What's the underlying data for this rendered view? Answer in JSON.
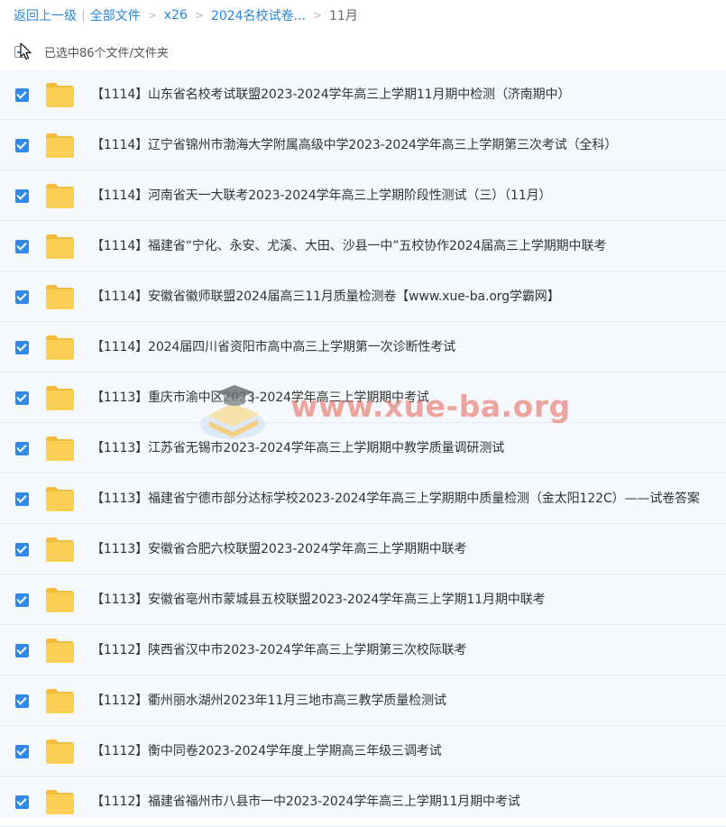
{
  "breadcrumb": {
    "back": "返回上一级",
    "all_files": "全部文件",
    "level1": "x26",
    "level2": "2024名校试卷...",
    "current": "11月",
    "pipe": "|",
    "sep": ">"
  },
  "selection": {
    "text": "已选中86个文件/文件夹"
  },
  "files": [
    {
      "name": "【1114】山东省名校考试联盟2023-2024学年高三上学期11月期中检测（济南期中）"
    },
    {
      "name": "【1114】辽宁省锦州市渤海大学附属高级中学2023-2024学年高三上学期第三次考试（全科）"
    },
    {
      "name": "【1114】河南省天一大联考2023-2024学年高三上学期阶段性测试（三）（11月）"
    },
    {
      "name": "【1114】福建省“宁化、永安、尤溪、大田、沙县一中”五校协作2024届高三上学期期中联考"
    },
    {
      "name": "【1114】安徽省徽师联盟2024届高三11月质量检测卷【www.xue-ba.org学霸网】"
    },
    {
      "name": "【1114】2024届四川省资阳市高中高三上学期第一次诊断性考试"
    },
    {
      "name": "【1113】重庆市渝中区2023-2024学年高三上学期期中考试"
    },
    {
      "name": "【1113】江苏省无锡市2023-2024学年高三上学期期中教学质量调研测试"
    },
    {
      "name": "【1113】福建省宁德市部分达标学校2023-2024学年高三上学期期中质量检测（金太阳122C）——试卷答案"
    },
    {
      "name": "【1113】安徽省合肥六校联盟2023-2024学年高三上学期期中联考"
    },
    {
      "name": "【1113】安徽省亳州市蒙城县五校联盟2023-2024学年高三上学期11月期中联考"
    },
    {
      "name": "【1112】陕西省汉中市2023-2024学年高三上学期第三次校际联考"
    },
    {
      "name": "【1112】衢州丽水湖州2023年11月三地市高三教学质量检测试"
    },
    {
      "name": "【1112】衡中同卷2023-2024学年度上学期高三年级三调考试"
    },
    {
      "name": "【1112】福建省福州市八县市一中2023-2024学年高三上学期11月期中考试"
    }
  ],
  "watermark": {
    "text": "www.xue-ba.org"
  },
  "colors": {
    "link": "#2a86d8",
    "checkbox": "#2e8ae6",
    "folder": "#f9cf55",
    "row_bg": "#f5f9fd"
  },
  "icons": {
    "folder": "folder-icon",
    "check": "checkbox-checked-icon",
    "cursor": "mouse-cursor-icon",
    "watermark_logo": "graduation-cap-book-logo"
  }
}
